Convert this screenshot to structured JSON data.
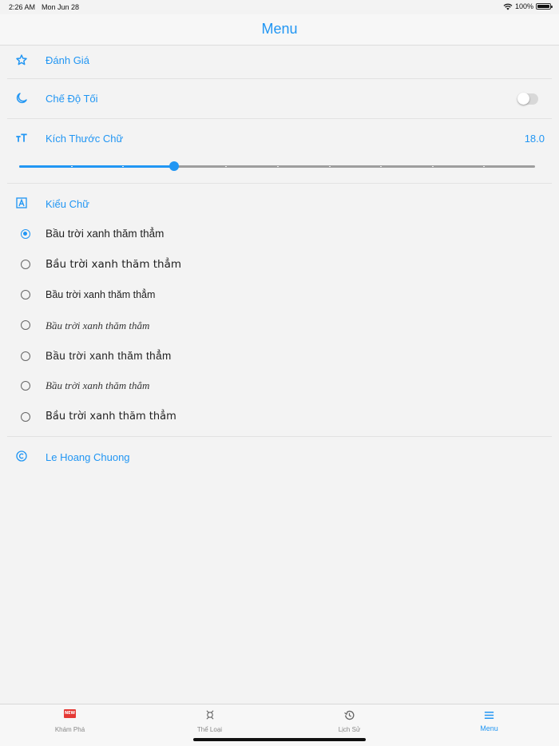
{
  "status_bar": {
    "time": "2:26 AM",
    "date": "Mon Jun 28",
    "battery": "100%"
  },
  "header": {
    "title": "Menu"
  },
  "accent_color": "#2196f3",
  "menu": {
    "rating_label": "Đánh Giá",
    "dark_mode_label": "Chế Độ Tối",
    "dark_mode_enabled": false,
    "font_size_label": "Kích Thước Chữ",
    "font_size_value": "18.0",
    "font_size_slider_fraction": 0.3,
    "font_style_label": "Kiểu Chữ",
    "font_options": [
      {
        "text": "Bầu trời xanh thăm thẳm",
        "selected": true
      },
      {
        "text": "Bầu trời xanh thăm thẳm",
        "selected": false
      },
      {
        "text": "Bầu trời xanh thăm thẳm",
        "selected": false
      },
      {
        "text": "Bầu trời xanh thăm thẳm",
        "selected": false
      },
      {
        "text": "Bầu trời xanh thăm thẳm",
        "selected": false
      },
      {
        "text": "Bầu trời xanh thăm thẳm",
        "selected": false
      },
      {
        "text": "Bầu trời xanh thăm thẳm",
        "selected": false
      }
    ],
    "author_label": "Le Hoang Chuong"
  },
  "tabs": [
    {
      "label": "Khám Phá",
      "icon": "new-badge-icon",
      "badge": "NEW",
      "active": false
    },
    {
      "label": "Thể Loại",
      "icon": "genre-icon",
      "active": false
    },
    {
      "label": "Lịch Sử",
      "icon": "history-icon",
      "active": false
    },
    {
      "label": "Menu",
      "icon": "menu-icon",
      "active": true
    }
  ]
}
